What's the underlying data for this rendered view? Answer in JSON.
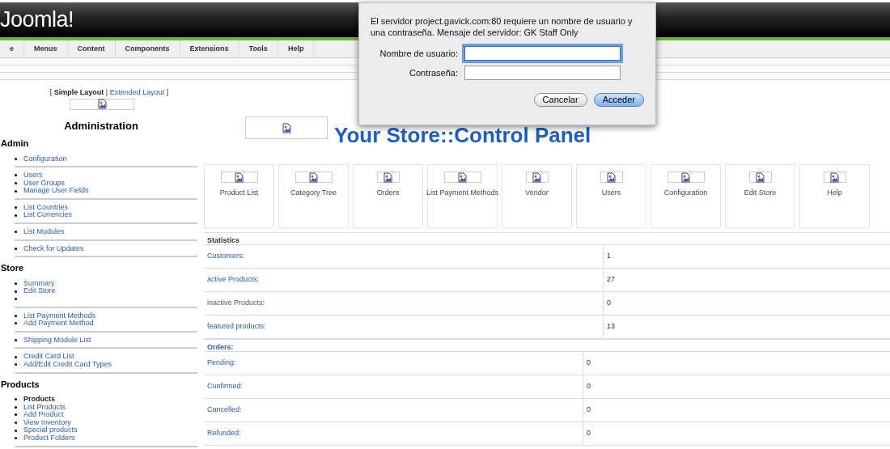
{
  "header": {
    "logo": "Joomla!"
  },
  "menu": [
    "e",
    "Menus",
    "Content",
    "Components",
    "Extensions",
    "Tools",
    "Help"
  ],
  "layout_brackets": {
    "open": "[",
    "separator": "|",
    "close": "]"
  },
  "layout_links": [
    {
      "label": "Simple Layout",
      "selected": true
    },
    {
      "label": "Extended Layout",
      "selected": false
    }
  ],
  "sidebar": {
    "title": "Administration",
    "sections": [
      {
        "heading": "Admin",
        "groups": [
          [
            {
              "kind": "link",
              "label": "Configuration"
            }
          ],
          [
            {
              "kind": "link",
              "label": "Users"
            },
            {
              "kind": "link",
              "label": "User Groups"
            },
            {
              "kind": "link",
              "label": "Manage User Fields"
            }
          ],
          [
            {
              "kind": "link",
              "label": "List Countries"
            },
            {
              "kind": "link",
              "label": "List Currencies"
            }
          ],
          [
            {
              "kind": "link",
              "label": "List Modules"
            }
          ],
          [
            {
              "kind": "link",
              "label": "Check for Updates"
            }
          ]
        ]
      },
      {
        "heading": "Store",
        "groups": [
          [
            {
              "kind": "link",
              "label": "Summary"
            },
            {
              "kind": "link",
              "label": "Edit Store"
            },
            {
              "kind": "blank"
            }
          ],
          [
            {
              "kind": "link",
              "label": "List Payment Methods"
            },
            {
              "kind": "link",
              "label": "Add Payment Method"
            }
          ],
          [
            {
              "kind": "link",
              "label": "Shipping Module List"
            }
          ],
          [
            {
              "kind": "link",
              "label": "Credit Card List"
            },
            {
              "kind": "link",
              "label": "Add/Edit Credit Card Types"
            }
          ]
        ]
      },
      {
        "heading": "Products",
        "groups": [
          [
            {
              "kind": "current",
              "label": "Products"
            },
            {
              "kind": "link",
              "label": "List Products"
            },
            {
              "kind": "link",
              "label": "Add Product"
            },
            {
              "kind": "link",
              "label": "View Inventory"
            },
            {
              "kind": "link",
              "label": "Special products"
            },
            {
              "kind": "link",
              "label": "Product Folders"
            }
          ]
        ]
      }
    ]
  },
  "page_title": "Your Store::Control Panel",
  "tiles": [
    {
      "label": "Product List",
      "wide": true
    },
    {
      "label": "Category Tree",
      "wide": true
    },
    {
      "label": "Orders",
      "wide": false
    },
    {
      "label": "List Payment Methods",
      "wide": true
    },
    {
      "label": "Vendor",
      "wide": false
    },
    {
      "label": "Users",
      "wide": false
    },
    {
      "label": "Configuration",
      "wide": true
    },
    {
      "label": "Edit Store",
      "wide": false
    },
    {
      "label": "Help",
      "wide": false
    }
  ],
  "statistics": {
    "title": "Statistics",
    "rows": [
      {
        "label": "Customers:",
        "value": "1",
        "link": true
      },
      {
        "label": "active Products:",
        "value": "27",
        "link": true
      },
      {
        "label": "inactive Products:",
        "value": "0",
        "link": false
      },
      {
        "label": "featured products:",
        "value": "13",
        "link": true
      }
    ]
  },
  "orders": {
    "title": "Orders:",
    "rows": [
      {
        "label": "Pending:",
        "value": "0",
        "link": true
      },
      {
        "label": "Confirmed:",
        "value": "0",
        "link": true
      },
      {
        "label": "Cancelled:",
        "value": "0",
        "link": true
      },
      {
        "label": "Refunded:",
        "value": "0",
        "link": true
      }
    ]
  },
  "dialog": {
    "message": "El servidor project.gavick.com:80 requiere un nombre de usuario y una contraseña. Mensaje del servidor: GK Staff Only",
    "fields": [
      {
        "label": "Nombre de usuario:",
        "focused": true
      },
      {
        "label": "Contraseña:",
        "focused": false
      }
    ],
    "buttons": [
      {
        "label": "Cancelar",
        "default": false
      },
      {
        "label": "Acceder",
        "default": true
      }
    ]
  }
}
